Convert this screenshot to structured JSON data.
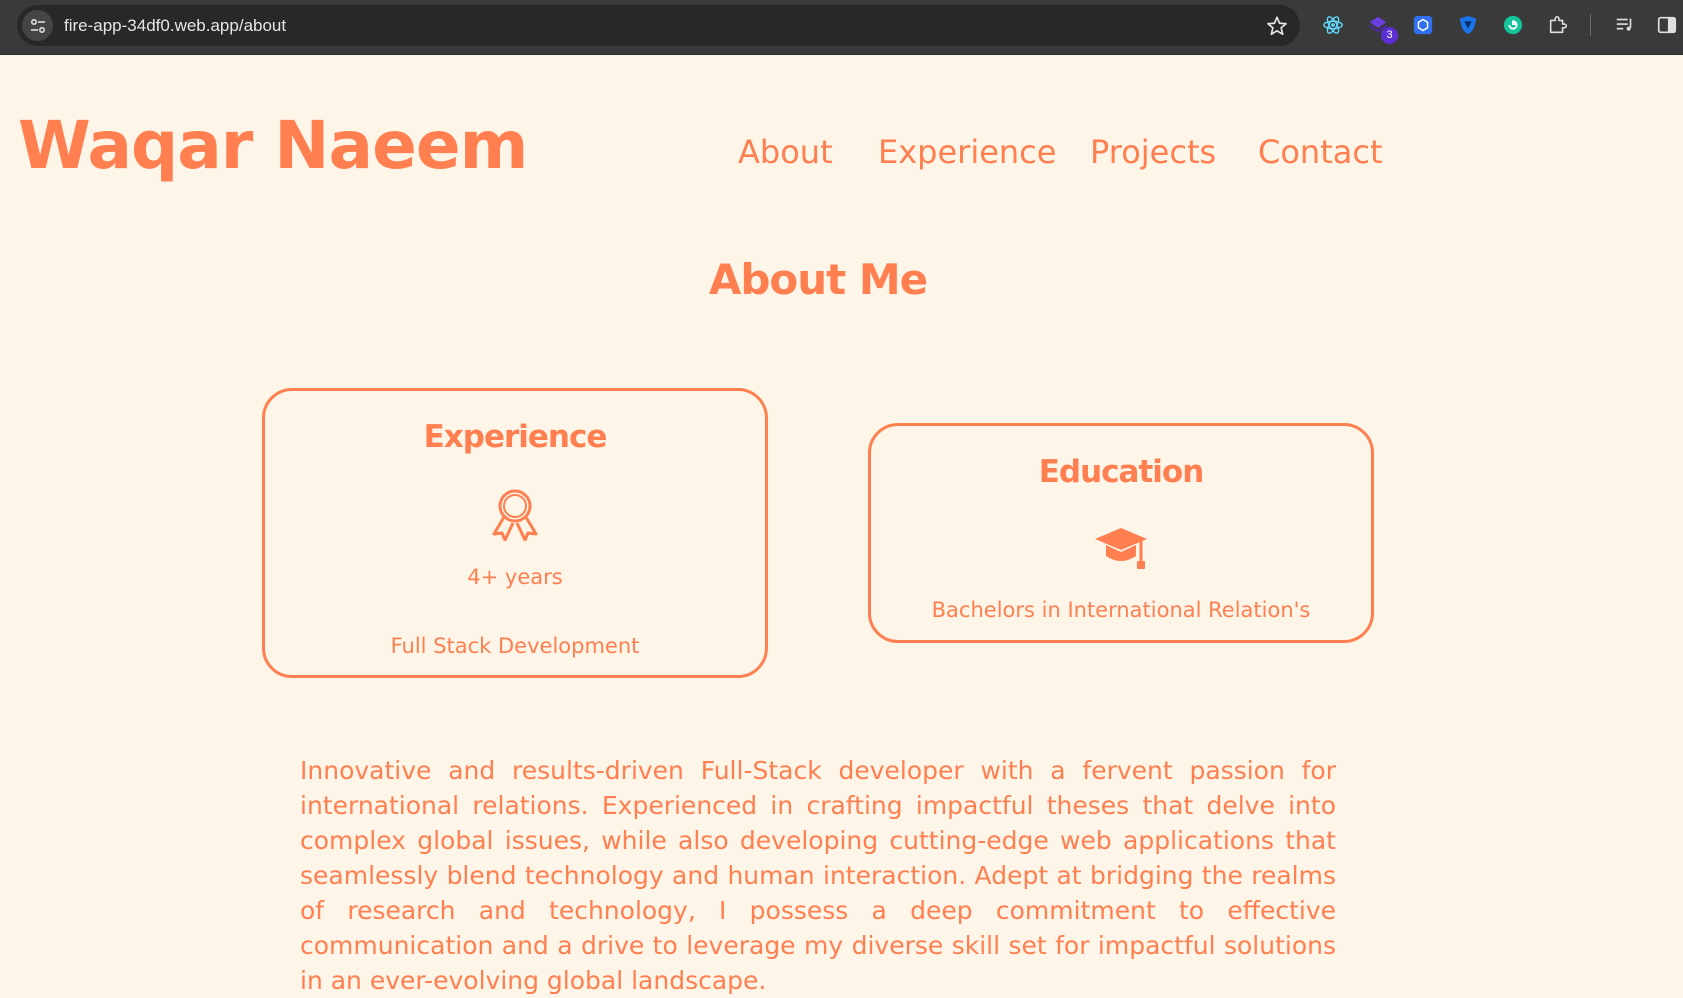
{
  "browser": {
    "url": "fire-app-34df0.web.app/about",
    "extension_badge": "3"
  },
  "header": {
    "brand": "Waqar Naeem",
    "nav": {
      "about": "About",
      "experience": "Experience",
      "projects": "Projects",
      "contact": "Contact"
    }
  },
  "about": {
    "title": "About Me",
    "experience_card": {
      "title": "Experience",
      "icon": "award-icon",
      "value": "4+ years",
      "subtitle": "Full Stack Development"
    },
    "education_card": {
      "title": "Education",
      "icon": "graduation-cap-icon",
      "subtitle": "Bachelors in International Relation's"
    },
    "bio": "Innovative and results-driven Full-Stack developer with a fervent passion for international relations. Experienced in crafting impactful theses that delve into complex global issues, while also developing cutting-edge web applications that seamlessly blend technology and human interaction. Adept at bridging the realms of research and technology, I possess a deep commitment to effective communication and a drive to leverage my diverse skill set for impactful solutions in an ever-evolving global landscape."
  },
  "colors": {
    "accent": "#ff7f50",
    "background": "#fdf5e8",
    "chrome": "#3a3a3a"
  }
}
